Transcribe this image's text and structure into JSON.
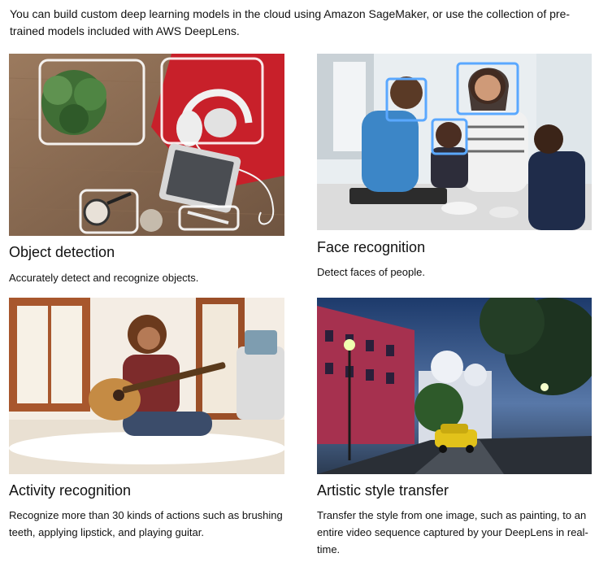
{
  "intro": {
    "text": "You can build custom deep learning models in the cloud using Amazon SageMaker, or use the collection of pre-trained models included with AWS DeepLens."
  },
  "cards": [
    {
      "title": "Object detection",
      "description": "Accurately detect and recognize objects.",
      "image_icon": "object-detection-photo"
    },
    {
      "title": "Face recognition",
      "description": "Detect faces of people.",
      "image_icon": "face-recognition-photo"
    },
    {
      "title": "Activity recognition",
      "description": "Recognize more than 30 kinds of actions such as brushing teeth, applying lipstick, and playing guitar.",
      "image_icon": "activity-recognition-photo"
    },
    {
      "title": "Artistic style transfer",
      "description": "Transfer the style from one image, such as painting, to an entire video sequence captured by your DeepLens in real-time.",
      "image_icon": "style-transfer-photo"
    }
  ],
  "colors": {
    "text": "#111111",
    "detection_box": "#ffffff",
    "face_box": "#5aa8ff"
  }
}
